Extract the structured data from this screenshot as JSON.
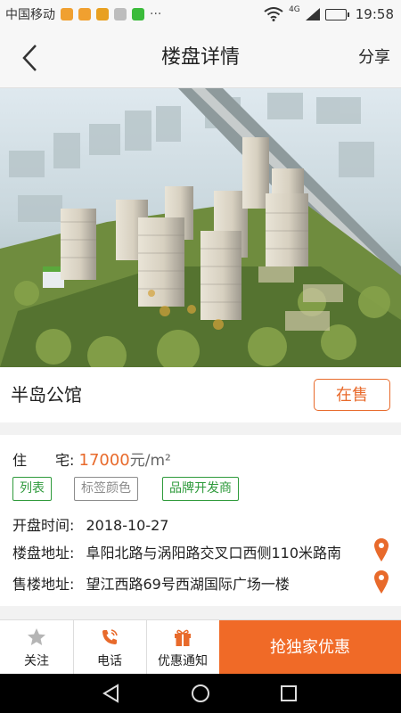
{
  "status_bar": {
    "carrier": "中国移动",
    "network": "4G",
    "time": "19:58",
    "more": "···"
  },
  "nav": {
    "title": "楼盘详情",
    "share": "分享"
  },
  "estate": {
    "name": "半岛公馆",
    "status": "在售"
  },
  "details": {
    "price_label": "住　　宅:",
    "price": "17000",
    "price_unit": "元/m²",
    "tags": [
      {
        "label": "列表",
        "color": "#2e9a3b"
      },
      {
        "label": "标签颜色",
        "color": "#8c8c8c"
      },
      {
        "label": "品牌开发商",
        "color": "#2e9a3b"
      }
    ],
    "open_label": "开盘时间:",
    "open_date": "2018-10-27",
    "addr_label": "楼盘地址:",
    "address": "阜阳北路与涡阳路交叉口西侧110米路南",
    "sales_label": "售楼地址:",
    "sales_address": "望江西路69号西湖国际广场一楼"
  },
  "tabbar": {
    "follow": "关注",
    "phone": "电话",
    "notice": "优惠通知",
    "cta": "抢独家优惠"
  },
  "colors": {
    "accent": "#f06a27",
    "tag_green": "#2e9a3b"
  }
}
